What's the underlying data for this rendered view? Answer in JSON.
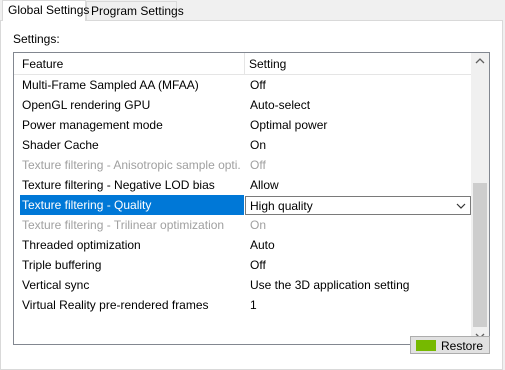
{
  "tabs": [
    {
      "label": "Global Settings",
      "active": true
    },
    {
      "label": "Program Settings",
      "active": false
    }
  ],
  "settings_label": "Settings:",
  "table": {
    "headers": {
      "feature": "Feature",
      "setting": "Setting"
    },
    "rows": [
      {
        "feature": "Multi-Frame Sampled AA (MFAA)",
        "setting": "Off",
        "disabled": false,
        "selected": false
      },
      {
        "feature": "OpenGL rendering GPU",
        "setting": "Auto-select",
        "disabled": false,
        "selected": false
      },
      {
        "feature": "Power management mode",
        "setting": "Optimal power",
        "disabled": false,
        "selected": false
      },
      {
        "feature": "Shader Cache",
        "setting": "On",
        "disabled": false,
        "selected": false
      },
      {
        "feature": "Texture filtering - Anisotropic sample opti...",
        "setting": "Off",
        "disabled": true,
        "selected": false
      },
      {
        "feature": "Texture filtering - Negative LOD bias",
        "setting": "Allow",
        "disabled": false,
        "selected": false
      },
      {
        "feature": "Texture filtering - Quality",
        "setting": "High quality",
        "disabled": false,
        "selected": true
      },
      {
        "feature": "Texture filtering - Trilinear optimization",
        "setting": "On",
        "disabled": true,
        "selected": false
      },
      {
        "feature": "Threaded optimization",
        "setting": "Auto",
        "disabled": false,
        "selected": false
      },
      {
        "feature": "Triple buffering",
        "setting": "Off",
        "disabled": false,
        "selected": false
      },
      {
        "feature": "Vertical sync",
        "setting": "Use the 3D application setting",
        "disabled": false,
        "selected": false
      },
      {
        "feature": "Virtual Reality pre-rendered frames",
        "setting": "1",
        "disabled": false,
        "selected": false
      }
    ]
  },
  "restore_button": {
    "label": "Restore"
  },
  "colors": {
    "selection": "#0078d7",
    "disabled_text": "#a0a0a0",
    "nvidia_green": "#76b900"
  }
}
